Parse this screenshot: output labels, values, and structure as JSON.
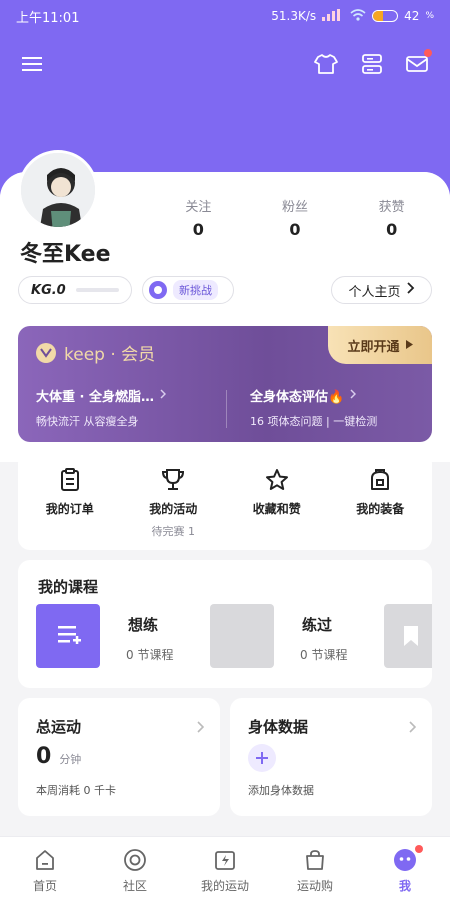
{
  "status_bar": {
    "time": "上午11:01",
    "speed": "51.3K/s",
    "battery": "42",
    "battery_unit": "%",
    "battery_level": 0.42
  },
  "colors": {
    "brand": "#7f69f2",
    "gold": "#f1d9a8",
    "badge": "#ff5a5a"
  },
  "top_icons": [
    "menu-icon",
    "shirt-icon",
    "server-icon",
    "mail-icon"
  ],
  "profile": {
    "username": "冬至Kee",
    "stats": [
      {
        "label": "关注",
        "value": "0"
      },
      {
        "label": "粉丝",
        "value": "0"
      },
      {
        "label": "获赞",
        "value": "0"
      }
    ],
    "kg_label": "KG.0",
    "challenge_label": "新挑战",
    "homepage_label": "个人主页"
  },
  "vip": {
    "brand": "keep · 会员",
    "open_label": "立即开通",
    "items": [
      {
        "title": "大体重 · 全身燃脂…",
        "subtitle": "畅快流汗 从容瘦全身"
      },
      {
        "title": "全身体态评估🔥",
        "subtitle": "16 项体态问题 | 一键检测"
      }
    ]
  },
  "quick_actions": [
    {
      "label": "我的订单",
      "sub": "",
      "icon": "clipboard-icon"
    },
    {
      "label": "我的活动",
      "sub": "待完赛 1",
      "icon": "trophy-icon"
    },
    {
      "label": "收藏和赞",
      "sub": "",
      "icon": "star-icon"
    },
    {
      "label": "我的装备",
      "sub": "",
      "icon": "bag-icon"
    }
  ],
  "courses": {
    "title": "我的课程",
    "items": [
      {
        "title": "想练",
        "count": "0 节课程"
      },
      {
        "title": "练过",
        "count": "0 节课程"
      }
    ]
  },
  "exercise": {
    "title": "总运动",
    "value": "0",
    "unit": "分钟",
    "subtitle": "本周消耗 0 千卡"
  },
  "body_data": {
    "title": "身体数据",
    "action": "添加身体数据"
  },
  "tabs": [
    {
      "label": "首页",
      "icon": "home-icon"
    },
    {
      "label": "社区",
      "icon": "community-icon"
    },
    {
      "label": "我的运动",
      "icon": "my-sport-icon"
    },
    {
      "label": "运动购",
      "icon": "shop-icon"
    },
    {
      "label": "我",
      "icon": "me-icon"
    }
  ]
}
